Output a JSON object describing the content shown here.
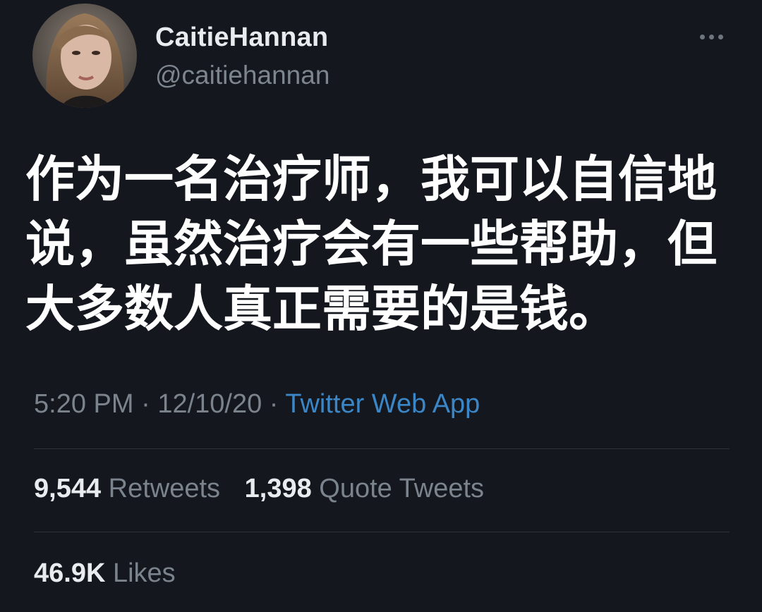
{
  "author": {
    "display_name": "CaitieHannan",
    "handle": "@caitiehannan"
  },
  "tweet": {
    "text": "作为一名治疗师，我可以自信地说，虽然治疗会有一些帮助，但大多数人真正需要的是钱。"
  },
  "meta": {
    "time": "5:20 PM",
    "separator": " · ",
    "date": "12/10/20",
    "source": "Twitter Web App"
  },
  "stats": {
    "retweets_count": "9,544",
    "retweets_label": "Retweets",
    "quotes_count": "1,398",
    "quotes_label": "Quote Tweets",
    "likes_count": "46.9K",
    "likes_label": "Likes"
  },
  "icons": {
    "more": "more-horizontal-icon",
    "avatar": "profile-photo"
  },
  "colors": {
    "background": "#14171e",
    "link": "#3b86c6",
    "secondary_text": "#7b838c",
    "primary_text": "#e9ecef"
  }
}
